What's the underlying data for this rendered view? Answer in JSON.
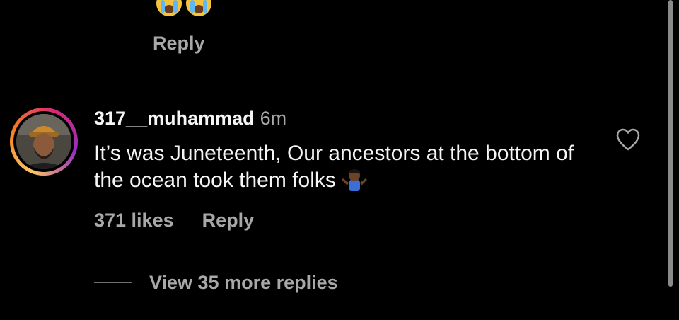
{
  "previous_comment": {
    "emojis": [
      "crying-face",
      "crying-face"
    ],
    "reply_label": "Reply"
  },
  "comment": {
    "username": "317__muhammad",
    "time": "6m",
    "text": "It’s was Juneteenth, Our ancestors at the bottom of the ocean took them folks",
    "trailing_emoji": "person-shrugging",
    "likes_label": "371 likes",
    "reply_label": "Reply",
    "liked": false
  },
  "view_more": {
    "label": "View 35 more replies"
  },
  "colors": {
    "background": "#000000",
    "primary_text": "#f5f5f5",
    "secondary_text": "#a8a8a8"
  }
}
